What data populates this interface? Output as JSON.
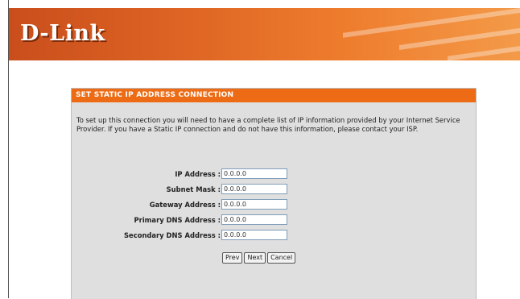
{
  "header": {
    "logo_text": "D-Link",
    "brand_colors": [
      "#c94e1c",
      "#ee7c2d",
      "#f39a48"
    ]
  },
  "panel": {
    "title": "SET STATIC IP ADDRESS CONNECTION",
    "title_bg_color": "#ec6b14",
    "intro": "To set up this connection you will need to have a complete list of IP information provided by your Internet Service Provider. If you have a Static IP connection and do not have this information, please contact your ISP."
  },
  "form": {
    "ip_address": {
      "label": "IP Address :",
      "value": "0.0.0.0"
    },
    "subnet_mask": {
      "label": "Subnet Mask :",
      "value": "0.0.0.0"
    },
    "gateway_address": {
      "label": "Gateway Address :",
      "value": "0.0.0.0"
    },
    "primary_dns": {
      "label": "Primary DNS Address :",
      "value": "0.0.0.0"
    },
    "secondary_dns": {
      "label": "Secondary DNS Address :",
      "value": "0.0.0.0"
    }
  },
  "buttons": {
    "prev": "Prev",
    "next": "Next",
    "cancel": "Cancel"
  }
}
